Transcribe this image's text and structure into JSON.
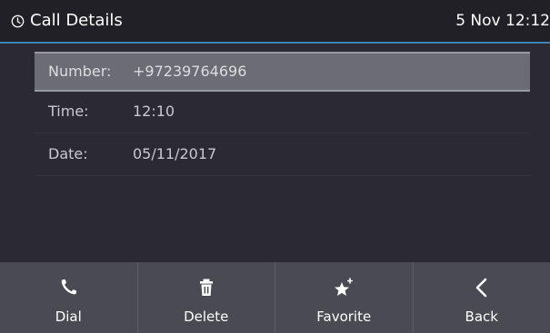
{
  "header": {
    "title": "Call Details",
    "datetime": "5 Nov 12:12"
  },
  "details": [
    {
      "label": "Number:",
      "value": "+97239764696",
      "selected": true
    },
    {
      "label": "Time:",
      "value": "12:10",
      "selected": false
    },
    {
      "label": "Date:",
      "value": "05/11/2017",
      "selected": false
    }
  ],
  "softkeys": [
    {
      "label": "Dial",
      "icon": "phone-icon"
    },
    {
      "label": "Delete",
      "icon": "trash-icon"
    },
    {
      "label": "Favorite",
      "icon": "star-plus-icon"
    },
    {
      "label": "Back",
      "icon": "chevron-left-icon"
    }
  ],
  "colors": {
    "accent": "#3e86b8",
    "background": "#2b2a33",
    "header": "#212026",
    "selected_row": "#6c6d74",
    "softkey_bar": "#4a4b52"
  }
}
